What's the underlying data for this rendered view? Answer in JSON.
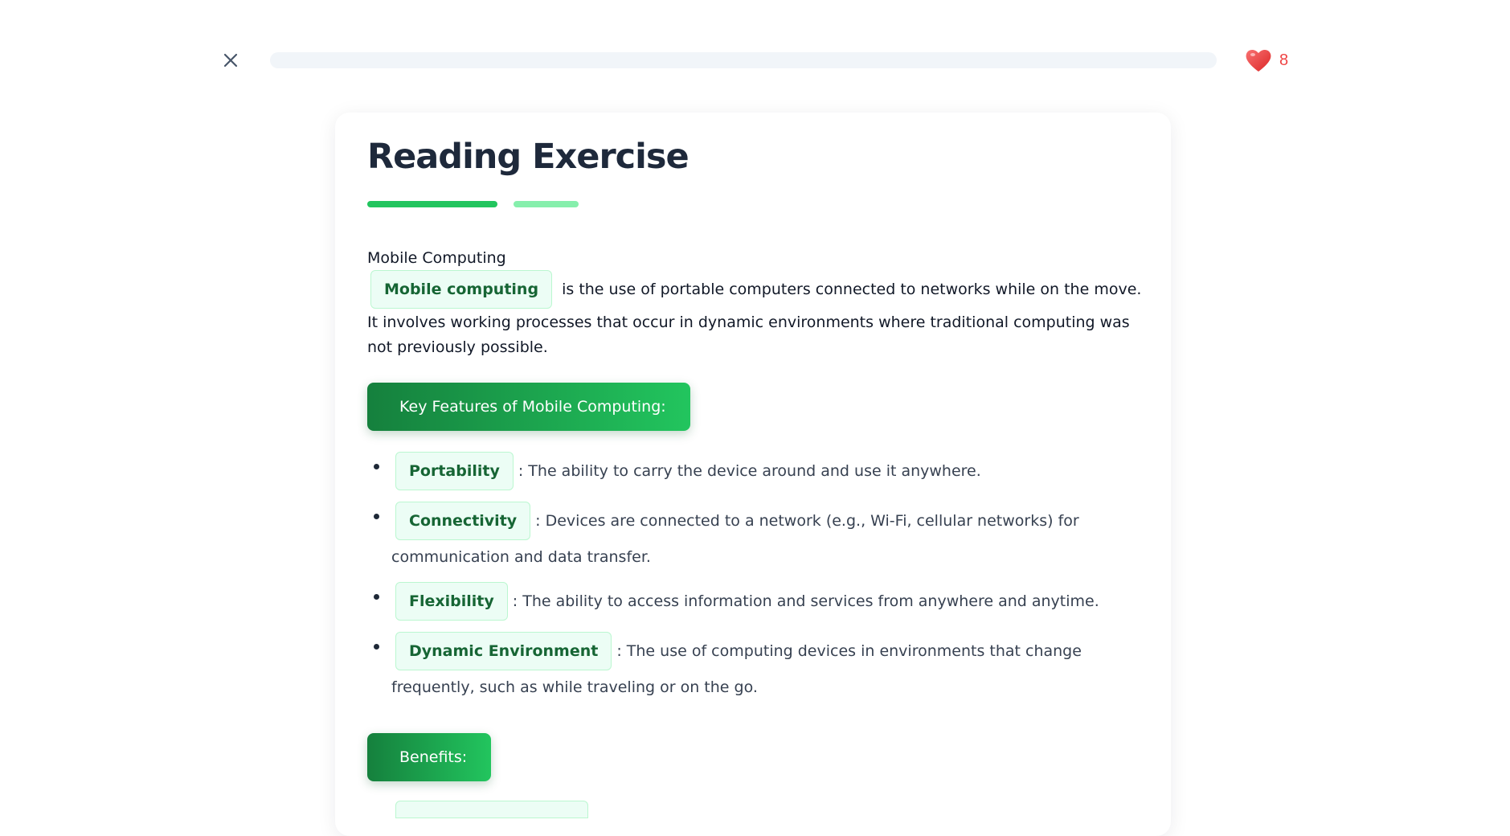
{
  "header": {
    "close_icon": "close-icon",
    "progress_percent": 0,
    "hearts_icon": "heart-icon",
    "hearts_count": "8",
    "colors": {
      "progress_track": "#f1f5f9",
      "heart": "#ef4444"
    }
  },
  "lesson": {
    "title": "Reading Exercise",
    "topic": "Mobile Computing",
    "intro": {
      "term": "Mobile computing",
      "text": " is the use of portable computers connected to networks while on the move. It involves working processes that occur in dynamic environments where traditional computing was not previously possible."
    },
    "sections": [
      {
        "header": "Key Features of Mobile Computing:",
        "items": [
          {
            "term": "Portability",
            "text": ": The ability to carry the device around and use it anywhere."
          },
          {
            "term": "Connectivity",
            "text": ": Devices are connected to a network (e.g., Wi-Fi, cellular networks) for communication and data transfer."
          },
          {
            "term": "Flexibility",
            "text": ": The ability to access information and services from anywhere and anytime."
          },
          {
            "term": "Dynamic Environment",
            "text": ": The use of computing devices in environments that change frequently, such as while traveling or on the go."
          }
        ]
      },
      {
        "header": "Benefits:"
      }
    ],
    "colors": {
      "accent": "#22c55e",
      "accent_light": "#86efac",
      "chip_bg": "#ecfdf5",
      "chip_text": "#166534"
    }
  }
}
